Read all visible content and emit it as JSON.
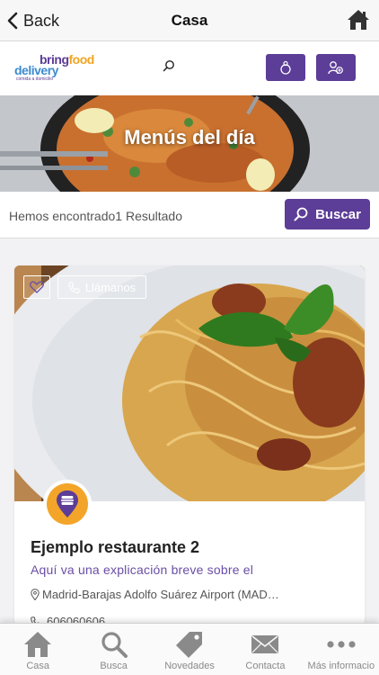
{
  "nav": {
    "back_label": "Back",
    "title": "Casa"
  },
  "brand": {
    "logo_bring": "bring",
    "logo_food": "food",
    "logo_delivery": "delivery",
    "logo_tagline": "comida a domicilio",
    "primary_color": "#5c3d97",
    "accent_color": "#f3a529"
  },
  "hero": {
    "title": "Menús del día"
  },
  "results": {
    "text": "Hemos encontrado1 Resultado",
    "search_button": "Buscar"
  },
  "card": {
    "call_label": "Llámanos",
    "name": "Ejemplo restaurante 2",
    "description": "Aquí va una explicación breve sobre el",
    "address": "Madrid-Barajas Adolfo Suárez Airport (MAD…",
    "phone": "606060606"
  },
  "tabs": [
    {
      "label": "Casa",
      "icon": "home-icon"
    },
    {
      "label": "Busca",
      "icon": "search-icon"
    },
    {
      "label": "Novedades",
      "icon": "tag-icon"
    },
    {
      "label": "Contacta",
      "icon": "mail-icon"
    },
    {
      "label": "Más informacio",
      "icon": "more-icon"
    }
  ]
}
